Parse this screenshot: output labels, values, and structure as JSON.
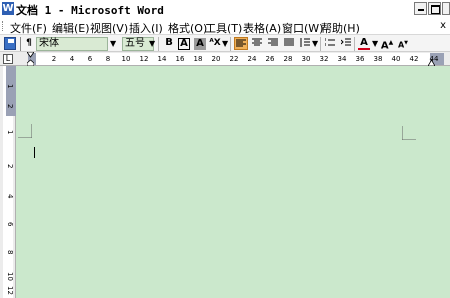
{
  "window": {
    "app_icon": "W",
    "title": "文档 1 - Microsoft Word"
  },
  "menubar": {
    "items": [
      {
        "label": "文件(F)"
      },
      {
        "label": "编辑(E)"
      },
      {
        "label": "视图(V)"
      },
      {
        "label": "插入(I)"
      },
      {
        "label": "格式(O)"
      },
      {
        "label": "工具(T)"
      },
      {
        "label": "表格(A)"
      },
      {
        "label": "窗口(W)"
      },
      {
        "label": "帮助(H)"
      }
    ],
    "close_doc": "x"
  },
  "toolbar": {
    "font_name": "宋体",
    "font_size": "五号",
    "bold": "B",
    "char_border": "A",
    "char_shading": "A",
    "font_color_label": "A",
    "grow_font": "A",
    "shrink_font": "A",
    "colors": {
      "font_color": "#d0021b",
      "active_button": "#f0b15a",
      "input_bg": "#d9ead3"
    }
  },
  "ruler": {
    "tab_marker": "L",
    "numbers": [
      "2",
      "4",
      "6",
      "8",
      "10",
      "12",
      "14",
      "16",
      "18",
      "20",
      "22",
      "24",
      "26",
      "28",
      "30",
      "32",
      "34",
      "36",
      "38",
      "40",
      "42",
      "44"
    ]
  },
  "vruler": {
    "numbers": [
      "1",
      "2",
      "1",
      "2",
      "4",
      "6",
      "8",
      "10",
      "12"
    ]
  },
  "document": {
    "background": "#cbe8cc"
  }
}
